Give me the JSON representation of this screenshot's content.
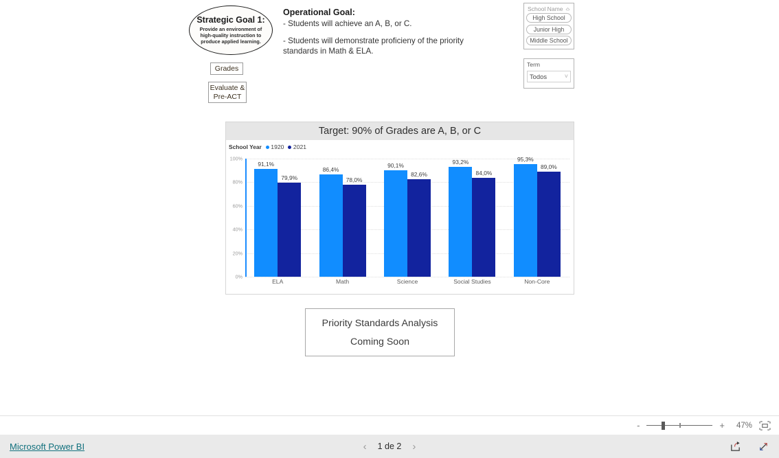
{
  "report": {
    "strategic_goal": {
      "title": "Strategic Goal 1:",
      "line1": "Provide an environment of",
      "line2": "high-quality instruction to",
      "line3": "produce applied learning."
    },
    "operational_goal": {
      "heading": "Operational Goal:",
      "bullet1": "- Students will achieve an A, B, or C.",
      "bullet2": "- Students will demonstrate proficieny of the priority",
      "bullet2_cont": "standards in Math & ELA."
    },
    "nav_buttons": [
      {
        "label": "Grades"
      },
      {
        "label": "Evaluate &\nPre-ACT",
        "line1": "Evaluate &",
        "line2": "Pre-ACT"
      }
    ],
    "slicers": {
      "school_name": {
        "title": "School Name",
        "clear_icon": "eraser-icon",
        "items": [
          "High School",
          "Junior High",
          "Middle School"
        ]
      },
      "term": {
        "label": "Term",
        "value": "Todos",
        "chevron_icon": "chevron-down-icon"
      }
    },
    "coming_soon": {
      "line1": "Priority Standards Analysis",
      "line2": "Coming Soon"
    }
  },
  "chart_data": {
    "type": "bar",
    "title": "Target: 90% of Grades are A, B, or C",
    "legend_title": "School Year",
    "legend_position": "top-left",
    "categories": [
      "ELA",
      "Math",
      "Science",
      "Social Studies",
      "Non-Core"
    ],
    "series": [
      {
        "name": "1920",
        "color": "#118DFF",
        "values": [
          91.1,
          86.4,
          90.1,
          93.2,
          95.3
        ],
        "labels": [
          "91,1%",
          "86,4%",
          "90,1%",
          "93,2%",
          "95,3%"
        ]
      },
      {
        "name": "2021",
        "color": "#12239E",
        "values": [
          79.9,
          78.0,
          82.6,
          84.0,
          89.0
        ],
        "labels": [
          "79,9%",
          "78,0%",
          "82,6%",
          "84,0%",
          "89,0%"
        ]
      }
    ],
    "xlabel": "",
    "ylabel": "",
    "ylim": [
      0,
      100
    ],
    "yticks": [
      0,
      20,
      40,
      60,
      80,
      100
    ],
    "ytick_labels": [
      "0%",
      "20%",
      "40%",
      "60%",
      "80%",
      "100%"
    ],
    "grid": true
  },
  "statusbar": {
    "zoom_minus": "-",
    "zoom_plus": "+",
    "zoom_percent": "47%",
    "fit_icon": "fit-to-page-icon"
  },
  "footer": {
    "brand_link": "Microsoft Power BI",
    "prev_icon": "chevron-left-icon",
    "page_label": "1 de 2",
    "next_icon": "chevron-right-icon",
    "share_icon": "share-icon",
    "fullscreen_icon": "fullscreen-icon"
  }
}
